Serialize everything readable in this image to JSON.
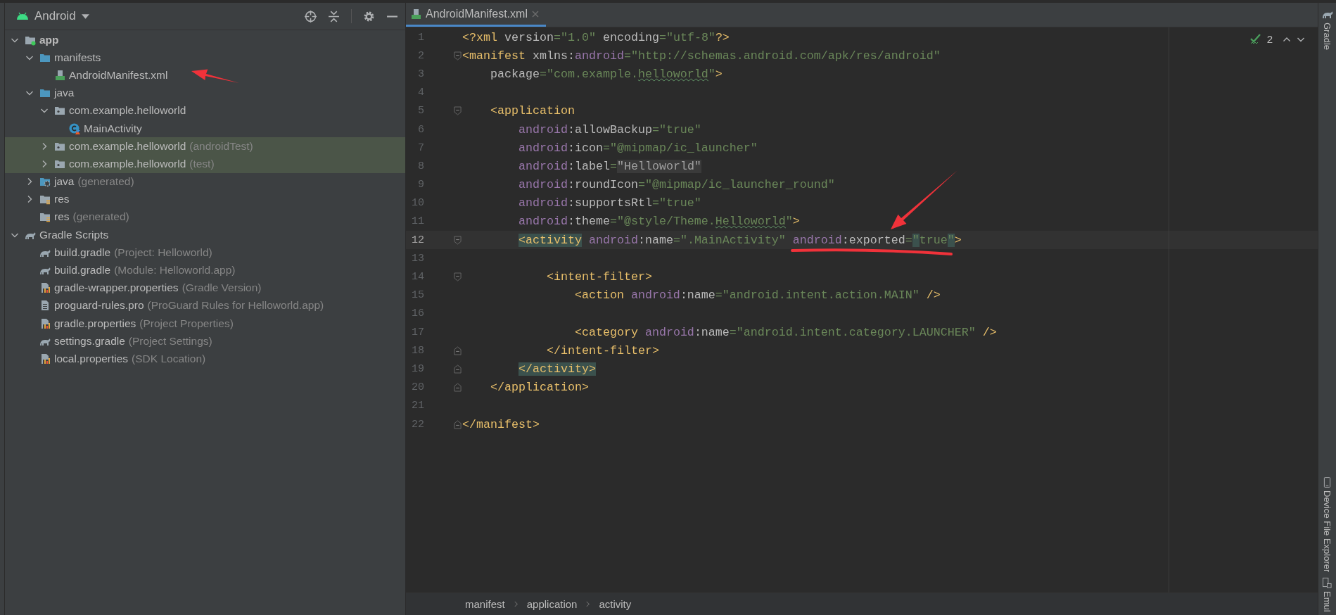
{
  "project_panel": {
    "view_selector": "Android",
    "tree": [
      {
        "label": "app",
        "kind": "module",
        "expanded": true,
        "selected": false,
        "children": [
          {
            "label": "manifests",
            "kind": "folder",
            "expanded": true,
            "selected": false,
            "children": [
              {
                "label": "AndroidManifest.xml",
                "kind": "manifest",
                "selected": false
              }
            ]
          },
          {
            "label": "java",
            "kind": "folder",
            "expanded": true,
            "selected": false,
            "children": [
              {
                "label": "com.example.helloworld",
                "kind": "package",
                "expanded": true,
                "selected": false,
                "children": [
                  {
                    "label": "MainActivity",
                    "kind": "class",
                    "selected": false
                  }
                ]
              },
              {
                "label": "com.example.helloworld",
                "suffix": "(androidTest)",
                "kind": "package",
                "expanded": false,
                "selected": true
              },
              {
                "label": "com.example.helloworld",
                "suffix": "(test)",
                "kind": "package",
                "expanded": false,
                "selected": true
              }
            ]
          },
          {
            "label": "java",
            "suffix": "(generated)",
            "kind": "generated",
            "expanded": false,
            "selected": false
          },
          {
            "label": "res",
            "kind": "res",
            "expanded": false,
            "selected": false
          },
          {
            "label": "res",
            "suffix": "(generated)",
            "kind": "res",
            "selected": false
          }
        ]
      },
      {
        "label": "Gradle Scripts",
        "kind": "gradle",
        "expanded": true,
        "selected": false,
        "children": [
          {
            "label": "build.gradle",
            "suffix": "(Project: Helloworld)",
            "kind": "gradle",
            "selected": false
          },
          {
            "label": "build.gradle",
            "suffix": "(Module: Helloworld.app)",
            "kind": "gradle",
            "selected": false
          },
          {
            "label": "gradle-wrapper.properties",
            "suffix": "(Gradle Version)",
            "kind": "properties",
            "selected": false
          },
          {
            "label": "proguard-rules.pro",
            "suffix": "(ProGuard Rules for Helloworld.app)",
            "kind": "text",
            "selected": false
          },
          {
            "label": "gradle.properties",
            "suffix": "(Project Properties)",
            "kind": "properties",
            "selected": false
          },
          {
            "label": "settings.gradle",
            "suffix": "(Project Settings)",
            "kind": "gradle",
            "selected": false
          },
          {
            "label": "local.properties",
            "suffix": "(SDK Location)",
            "kind": "properties",
            "selected": false
          }
        ]
      }
    ]
  },
  "editor": {
    "tabs": [
      {
        "label": "AndroidManifest.xml",
        "selected": true
      }
    ],
    "problem_count": "2",
    "lines": [
      {
        "number": "1",
        "current": false,
        "tokens": [
          {
            "text": "<?xml",
            "kind": "tag"
          },
          {
            "text": " version",
            "kind": "attr"
          },
          {
            "text": "=\"1.0\"",
            "kind": "value"
          },
          {
            "text": " encoding",
            "kind": "attr"
          },
          {
            "text": "=\"utf-8\"",
            "kind": "value"
          },
          {
            "text": "?>",
            "kind": "tag"
          }
        ]
      },
      {
        "number": "2",
        "current": false,
        "fold_open": true,
        "tokens": [
          {
            "text": "<manifest",
            "kind": "tag"
          },
          {
            "text": " xmlns:",
            "kind": "attr"
          },
          {
            "text": "android",
            "kind": "ns"
          },
          {
            "text": "=\"http://schemas.android.com/apk/res/android\"",
            "kind": "value"
          }
        ]
      },
      {
        "number": "3",
        "current": false,
        "tokens": [
          {
            "text": "    package",
            "kind": "attr"
          },
          {
            "text": "=\"com.example.",
            "kind": "value"
          },
          {
            "text": "helloworld",
            "kind": "value",
            "typo": true
          },
          {
            "text": "\"",
            "kind": "value"
          },
          {
            "text": ">",
            "kind": "tag"
          }
        ]
      },
      {
        "number": "4",
        "current": false
      },
      {
        "number": "5",
        "current": false,
        "fold_open": true,
        "tokens": [
          {
            "text": "    <application",
            "kind": "tag"
          }
        ]
      },
      {
        "number": "6",
        "current": false,
        "tokens": [
          {
            "text": "        android",
            "kind": "ns"
          },
          {
            "text": ":allowBackup",
            "kind": "attr"
          },
          {
            "text": "=\"true\"",
            "kind": "value"
          }
        ]
      },
      {
        "number": "7",
        "current": false,
        "tokens": [
          {
            "text": "        android",
            "kind": "ns"
          },
          {
            "text": ":icon",
            "kind": "attr"
          },
          {
            "text": "=\"@mipmap/ic_launcher\"",
            "kind": "value"
          }
        ]
      },
      {
        "number": "8",
        "current": false,
        "tokens": [
          {
            "text": "        android",
            "kind": "ns"
          },
          {
            "text": ":label",
            "kind": "attr"
          },
          {
            "text": "=",
            "kind": "value"
          },
          {
            "text": "\"Helloworld\"",
            "kind": "plain",
            "reference": true
          }
        ]
      },
      {
        "number": "9",
        "current": false,
        "tokens": [
          {
            "text": "        android",
            "kind": "ns"
          },
          {
            "text": ":roundIcon",
            "kind": "attr"
          },
          {
            "text": "=\"@mipmap/ic_launcher_round\"",
            "kind": "value"
          }
        ]
      },
      {
        "number": "10",
        "current": false,
        "tokens": [
          {
            "text": "        android",
            "kind": "ns"
          },
          {
            "text": ":supportsRtl",
            "kind": "attr"
          },
          {
            "text": "=\"true\"",
            "kind": "value"
          }
        ]
      },
      {
        "number": "11",
        "current": false,
        "tokens": [
          {
            "text": "        android",
            "kind": "ns"
          },
          {
            "text": ":theme",
            "kind": "attr"
          },
          {
            "text": "=\"@style/Theme.",
            "kind": "value"
          },
          {
            "text": "Helloworld",
            "kind": "value",
            "typo": true
          },
          {
            "text": "\"",
            "kind": "value"
          },
          {
            "text": ">",
            "kind": "tag"
          }
        ]
      },
      {
        "number": "12",
        "current": true,
        "fold_open": true,
        "tokens": [
          {
            "text": "        <activity",
            "kind": "tag",
            "matched": true
          },
          {
            "text": " android",
            "kind": "ns"
          },
          {
            "text": ":name",
            "kind": "attr"
          },
          {
            "text": "=\".MainActivity\"",
            "kind": "value"
          },
          {
            "text": " android",
            "kind": "ns"
          },
          {
            "text": ":exported",
            "kind": "attr"
          },
          {
            "text": "=",
            "kind": "value"
          },
          {
            "text": "\"",
            "kind": "value",
            "matched": true
          },
          {
            "text": "true",
            "kind": "value"
          },
          {
            "text": "\"",
            "kind": "value",
            "matched": true
          },
          {
            "text": ">",
            "kind": "tag"
          }
        ]
      },
      {
        "number": "13",
        "current": false
      },
      {
        "number": "14",
        "current": false,
        "fold_open": true,
        "tokens": [
          {
            "text": "            <intent-filter>",
            "kind": "tag"
          }
        ]
      },
      {
        "number": "15",
        "current": false,
        "tokens": [
          {
            "text": "                <action",
            "kind": "tag"
          },
          {
            "text": " android",
            "kind": "ns"
          },
          {
            "text": ":name",
            "kind": "attr"
          },
          {
            "text": "=\"android.intent.action.MAIN\"",
            "kind": "value"
          },
          {
            "text": " />",
            "kind": "tag"
          }
        ]
      },
      {
        "number": "16",
        "current": false
      },
      {
        "number": "17",
        "current": false,
        "tokens": [
          {
            "text": "                <category",
            "kind": "tag"
          },
          {
            "text": " android",
            "kind": "ns"
          },
          {
            "text": ":name",
            "kind": "attr"
          },
          {
            "text": "=\"android.intent.category.LAUNCHER\"",
            "kind": "value"
          },
          {
            "text": " />",
            "kind": "tag"
          }
        ]
      },
      {
        "number": "18",
        "current": false,
        "fold_close": true,
        "tokens": [
          {
            "text": "            </intent-filter>",
            "kind": "tag"
          }
        ]
      },
      {
        "number": "19",
        "current": false,
        "fold_close": true,
        "tokens": [
          {
            "text": "        </activity>",
            "kind": "tag",
            "matched": true
          }
        ]
      },
      {
        "number": "20",
        "current": false,
        "fold_close": true,
        "tokens": [
          {
            "text": "    </application>",
            "kind": "tag"
          }
        ]
      },
      {
        "number": "21",
        "current": false
      },
      {
        "number": "22",
        "current": false,
        "fold_close": true,
        "tokens": [
          {
            "text": "</manifest>",
            "kind": "tag"
          }
        ]
      }
    ],
    "breadcrumbs": [
      "manifest",
      "application",
      "activity"
    ]
  },
  "tool_windows": [
    {
      "label": "Gradle",
      "kind": "gradle"
    },
    {
      "label": "Device File Explorer",
      "kind": "device"
    },
    {
      "label": "Emul",
      "kind": "emulator"
    }
  ]
}
